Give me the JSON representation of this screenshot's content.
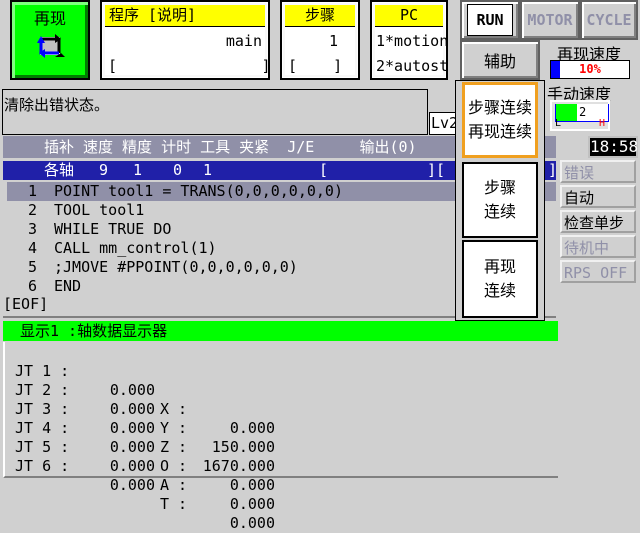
{
  "mode": {
    "label": "再现",
    "icon": "repeat-cycle-icon"
  },
  "program": {
    "header": "程序  [说明]",
    "name": "main",
    "comment": "[                ]"
  },
  "step": {
    "header": "步骤",
    "value": "1",
    "comment": "[    ]"
  },
  "pc": {
    "header": "PC",
    "items": [
      "1*motion",
      "2*autost"
    ]
  },
  "top_buttons": {
    "run": "RUN",
    "motor": "MOTOR",
    "cycle": "CYCLE"
  },
  "aux_button": "辅助",
  "repeat_speed": {
    "label": "再现速度",
    "value": "10%",
    "percent": 10
  },
  "manual_speed": {
    "label": "手动速度",
    "value": "2",
    "low": "L",
    "high": "H",
    "level": 2,
    "max": 5
  },
  "message": "清除出错状态。",
  "level": "Lv2",
  "time": "18:58",
  "param_header": "插补 速度 精度 计时 工具 夹紧  J/E     输出(0)",
  "param_values": {
    "interp": "各轴",
    "speed": "9",
    "accuracy": "1",
    "timer": "0",
    "tool": "1",
    "je_open": "[",
    "je_close": "][",
    "out_close": "]"
  },
  "program_lines": [
    {
      "num": "1",
      "code": "POINT tool1 = TRANS(0,0,0,0,0,0)"
    },
    {
      "num": "2",
      "code": "TOOL tool1"
    },
    {
      "num": "3",
      "code": "WHILE TRUE DO"
    },
    {
      "num": "4",
      "code": "CALL mm_control(1)"
    },
    {
      "num": "5",
      "code": ";JMOVE #PPOINT(0,0,0,0,0,0)"
    },
    {
      "num": "6",
      "code": "END"
    }
  ],
  "eof": "[EOF]",
  "popup": {
    "items": [
      "步骤连续\n再现连续",
      "步骤\n连续",
      "再现\n连续"
    ],
    "selected": 0
  },
  "status": [
    {
      "label": "错误",
      "active": false
    },
    {
      "label": "自动",
      "active": true
    },
    {
      "label": "检查单步",
      "active": true
    },
    {
      "label": "待机中",
      "active": false
    },
    {
      "label": "RPS OFF",
      "active": false
    }
  ],
  "display": {
    "header": "显示1 :轴数据显示器",
    "rows": [
      {
        "jt": "JT 1 :",
        "jv": "0.000",
        "ax": "X :",
        "av": "0.000"
      },
      {
        "jt": "JT 2 :",
        "jv": "0.000",
        "ax": "Y :",
        "av": "150.000"
      },
      {
        "jt": "JT 3 :",
        "jv": "0.000",
        "ax": "Z :",
        "av": "1670.000"
      },
      {
        "jt": "JT 4 :",
        "jv": "0.000",
        "ax": "O :",
        "av": "0.000"
      },
      {
        "jt": "JT 5 :",
        "jv": "0.000",
        "ax": "A :",
        "av": "0.000"
      },
      {
        "jt": "JT 6 :",
        "jv": "0.000",
        "ax": "T :",
        "av": "0.000"
      }
    ]
  },
  "colors": {
    "mode_bg": "#00ff00",
    "header_yellow": "#ffff00",
    "row_blue": "#2020a8",
    "header_gray": "#9090a8",
    "selected_border": "#f0a020"
  }
}
